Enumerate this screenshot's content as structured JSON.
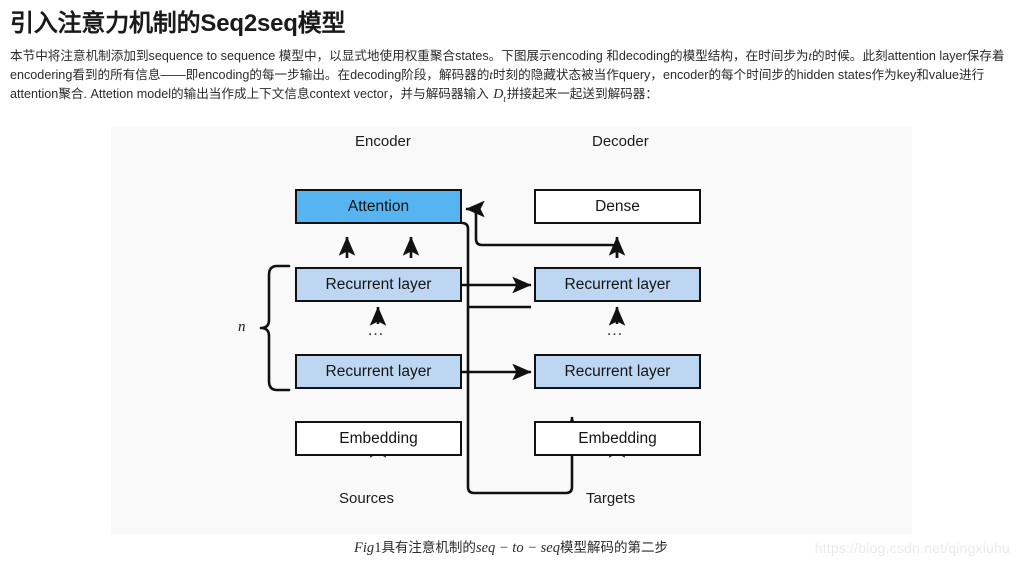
{
  "article": {
    "title": "引入注意力机制的Seq2seq模型",
    "paragraph": {
      "seg1": "本节中将注意机制添加到sequence to sequence 模型中，以显式地使用权重聚合states。下图展示encoding 和decoding的模型结构，在时间步为",
      "var_t_1": "t",
      "seg2": "的时候。此刻attention layer保存着encodering看到的所有信息——即encoding的每一步输出。在decoding阶段，解码器的",
      "var_t_2": "t",
      "seg3": "时刻的隐藏状态被当作query，encoder的每个时间步的hidden states作为key和value进行attention聚合. Attetion model的输出当作成上下文信息context vector，并与解码器输入 ",
      "math_D": "D",
      "math_D_sub": "t",
      "seg4": "拼接起来一起送到解码器："
    }
  },
  "figure": {
    "group_labels": {
      "encoder": "Encoder",
      "decoder": "Decoder"
    },
    "nodes": {
      "attention": "Attention",
      "dense": "Dense",
      "encoder_recurrent_top": "Recurrent layer",
      "encoder_recurrent_bottom": "Recurrent layer",
      "decoder_recurrent_top": "Recurrent layer",
      "decoder_recurrent_bottom": "Recurrent layer",
      "encoder_embedding": "Embedding",
      "decoder_embedding": "Embedding"
    },
    "io_labels": {
      "sources": "Sources",
      "targets": "Targets"
    },
    "ellipsis": "…",
    "stack_count_label": "n",
    "colors": {
      "attention_fill": "#56b4f0",
      "recurrent_fill": "#bdd7f2",
      "plain_fill": "#ffffff",
      "stroke": "#111111",
      "panel_background": "#f9f9f9"
    }
  },
  "caption": {
    "fig_prefix": "Fig",
    "fig_number": "1",
    "text_cjk_1": "具有注意机制的",
    "math_seq": "seq − to − seq",
    "text_cjk_2": "模型解码的第二步"
  },
  "watermark": {
    "url": "https://blog.csdn.net/qingxiuhu"
  }
}
